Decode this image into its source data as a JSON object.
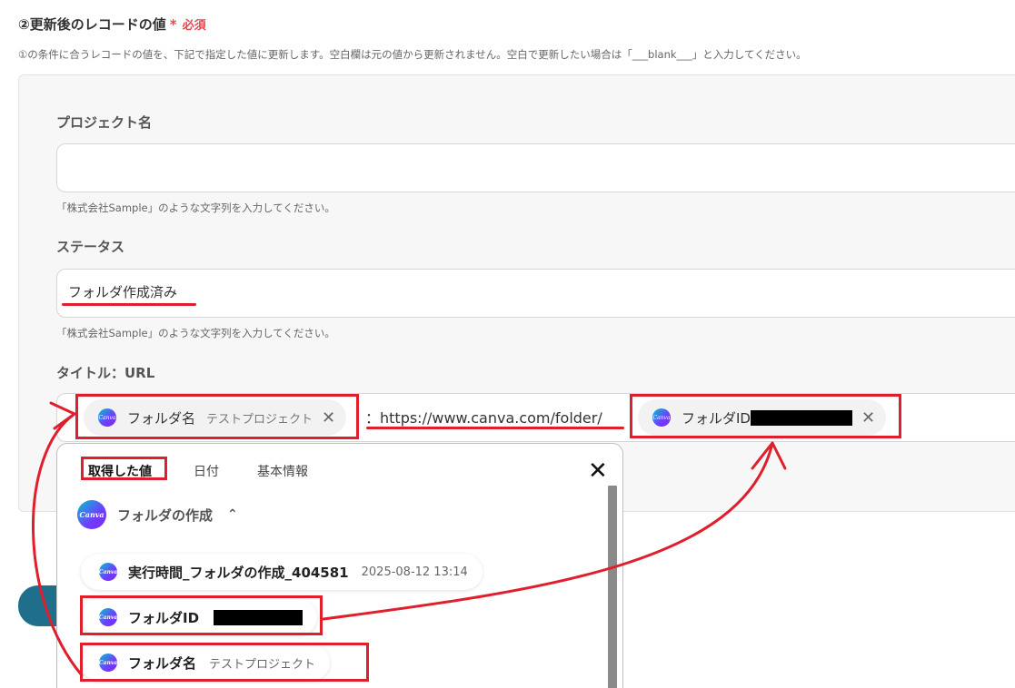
{
  "section": {
    "title": "②更新後のレコードの値",
    "required_star": "*",
    "required_label": "必須",
    "description": "①の条件に合うレコードの値を、下記で指定した値に更新します。空白欄は元の値から更新されません。空白で更新したい場合は「___blank___」と入力してください。"
  },
  "fields": {
    "project": {
      "label": "プロジェクト名",
      "value": "",
      "hint": "「株式会社Sample」のような文字列を入力してください。"
    },
    "status": {
      "label": "ステータス",
      "value": "フォルダ作成済み",
      "hint": "「株式会社Sample」のような文字列を入力してください。"
    },
    "title_url": {
      "label": "タイトル：URL",
      "token1": {
        "label": "フォルダ名",
        "value": "テストプロジェクト"
      },
      "separator_text": "：https://www.canva.com/folder/",
      "token2": {
        "label": "フォルダID"
      }
    }
  },
  "dropdown": {
    "tabs": [
      "取得した値",
      "日付",
      "基本情報"
    ],
    "group": {
      "label": "フォルダの作成"
    },
    "items": [
      {
        "label": "実行時間_フォルダの作成_404581",
        "value": "2025-08-12 13:14"
      },
      {
        "label": "フォルダID",
        "value": ""
      },
      {
        "label": "フォルダ名",
        "value": "テストプロジェクト"
      }
    ]
  },
  "icons": {
    "canva": "canva-logo-icon",
    "close": "close-icon",
    "chevron": "chevron-up-icon",
    "remove": "remove-token-icon"
  },
  "icon_text": {
    "canva": "Canva"
  },
  "colors": {
    "annotation_red": "#e01f2d",
    "required_red": "#e5484d",
    "accent_button": "#1f6e8c"
  }
}
